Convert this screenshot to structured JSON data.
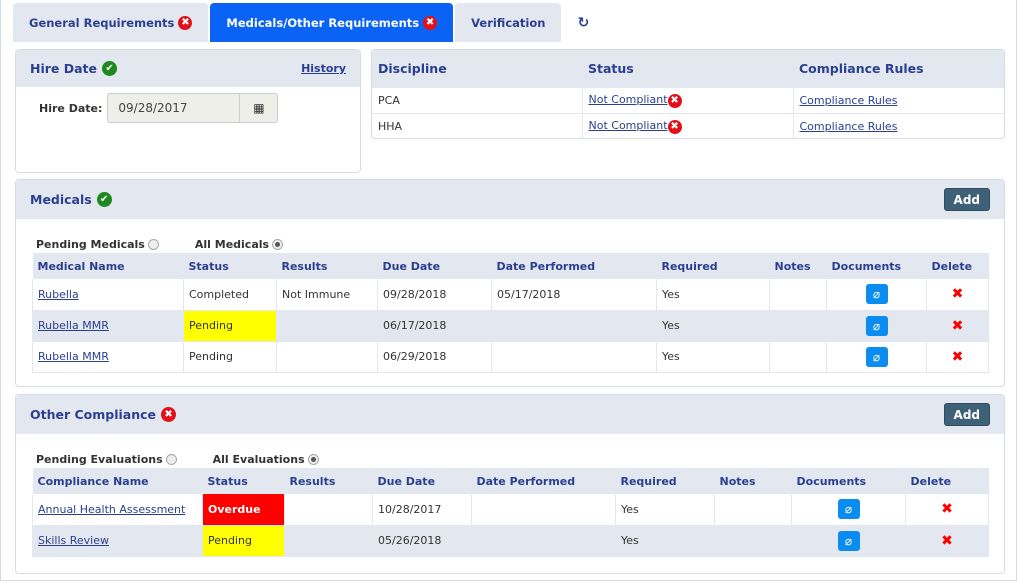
{
  "tabs": [
    {
      "label": "General Requirements",
      "status": "error"
    },
    {
      "label": "Medicals/Other Requirements",
      "status": "error",
      "active": true
    },
    {
      "label": "Verification"
    }
  ],
  "icons": {
    "refresh": "↻",
    "error": "✖",
    "check": "✔",
    "calendar": "▦",
    "paperclip": "🔗",
    "delete": "✖"
  },
  "colors": {
    "accent": "#0b63f6",
    "header_bg": "#e3e7f0",
    "title_text": "#2a3f8f",
    "pending": "#ffff00",
    "overdue": "#ff0000",
    "add_button": "#3f6178"
  },
  "hire_date": {
    "title": "Hire Date",
    "history_link": "History",
    "label": "Hire Date:",
    "value": "09/28/2017"
  },
  "discipline": {
    "headers": [
      "Discipline",
      "Status",
      "Compliance Rules"
    ],
    "rows": [
      {
        "discipline": "PCA",
        "status": "Not Compliant",
        "rules": "Compliance Rules"
      },
      {
        "discipline": "HHA",
        "status": "Not Compliant",
        "rules": "Compliance Rules"
      }
    ]
  },
  "medicals": {
    "title": "Medicals",
    "add_label": "Add",
    "filter_pending": "Pending Medicals",
    "filter_all": "All Medicals",
    "headers": [
      "Medical Name",
      "Status",
      "Results",
      "Due Date",
      "Date Performed",
      "Required",
      "Notes",
      "Documents",
      "Delete"
    ],
    "rows": [
      {
        "name": "Rubella",
        "status": "Completed",
        "results": "Not Immune",
        "due": "09/28/2018",
        "performed": "05/17/2018",
        "required": "Yes",
        "notes": ""
      },
      {
        "name": "Rubella MMR",
        "status": "Pending",
        "results": "",
        "due": "06/17/2018",
        "performed": "",
        "required": "Yes",
        "notes": ""
      },
      {
        "name": "Rubella MMR",
        "status": "Pending",
        "results": "",
        "due": "06/29/2018",
        "performed": "",
        "required": "Yes",
        "notes": ""
      }
    ]
  },
  "other": {
    "title": "Other Compliance",
    "add_label": "Add",
    "filter_pending": "Pending Evaluations",
    "filter_all": "All Evaluations",
    "headers": [
      "Compliance Name",
      "Status",
      "Results",
      "Due Date",
      "Date Performed",
      "Required",
      "Notes",
      "Documents",
      "Delete"
    ],
    "rows": [
      {
        "name": "Annual Health Assessment",
        "status": "Overdue",
        "results": "",
        "due": "10/28/2017",
        "performed": "",
        "required": "Yes",
        "notes": ""
      },
      {
        "name": "Skills Review",
        "status": "Pending",
        "results": "",
        "due": "05/26/2018",
        "performed": "",
        "required": "Yes",
        "notes": ""
      }
    ]
  }
}
